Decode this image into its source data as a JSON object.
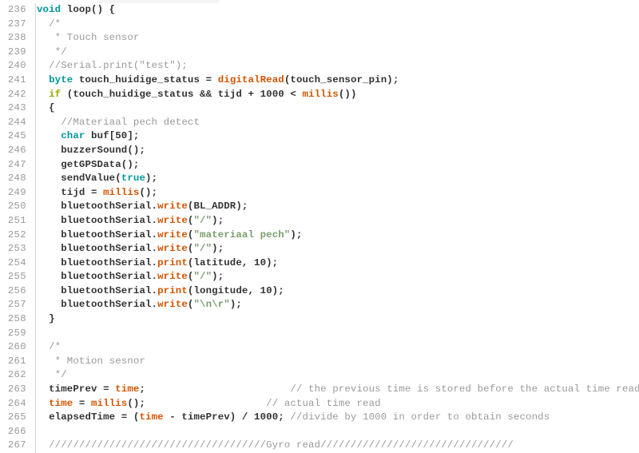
{
  "editor": {
    "app": "arduino-code-editor",
    "background_color": "#ffffff",
    "gutter_color": "#9a9a9a",
    "gutter_rule_color": "#d4d4d4",
    "first_visible_line": 236,
    "last_visible_line": 267,
    "visible_line_count": 32,
    "font": "monospace-bold",
    "colors": {
      "plain": "#333333",
      "keyword": "#00979c",
      "control": "#a1a100",
      "function": "#d35400",
      "string": "#7a9e6c",
      "comment": "#9a9a9a"
    }
  },
  "lines": [
    {
      "n": "236",
      "tokens": [
        {
          "t": "keyword",
          "s": "void"
        },
        {
          "t": "plain",
          "s": " loop() {"
        }
      ]
    },
    {
      "n": "237",
      "tokens": [
        {
          "t": "comment",
          "s": "  /*"
        }
      ]
    },
    {
      "n": "238",
      "tokens": [
        {
          "t": "comment",
          "s": "   * Touch sensor"
        }
      ]
    },
    {
      "n": "239",
      "tokens": [
        {
          "t": "comment",
          "s": "   */"
        }
      ]
    },
    {
      "n": "240",
      "tokens": [
        {
          "t": "comment",
          "s": "  //Serial.print(\"test\");"
        }
      ]
    },
    {
      "n": "241",
      "tokens": [
        {
          "t": "plain",
          "s": "  "
        },
        {
          "t": "keyword",
          "s": "byte"
        },
        {
          "t": "plain",
          "s": " touch_huidige_status = "
        },
        {
          "t": "function",
          "s": "digitalRead"
        },
        {
          "t": "plain",
          "s": "(touch_sensor_pin);"
        }
      ]
    },
    {
      "n": "242",
      "tokens": [
        {
          "t": "plain",
          "s": "  "
        },
        {
          "t": "control",
          "s": "if"
        },
        {
          "t": "plain",
          "s": " (touch_huidige_status && tijd + 1000 < "
        },
        {
          "t": "function",
          "s": "millis"
        },
        {
          "t": "plain",
          "s": "())"
        }
      ]
    },
    {
      "n": "243",
      "tokens": [
        {
          "t": "plain",
          "s": "  {"
        }
      ]
    },
    {
      "n": "244",
      "tokens": [
        {
          "t": "comment",
          "s": "    //Materiaal pech detect"
        }
      ]
    },
    {
      "n": "245",
      "tokens": [
        {
          "t": "plain",
          "s": "    "
        },
        {
          "t": "keyword",
          "s": "char"
        },
        {
          "t": "plain",
          "s": " buf[50];"
        }
      ]
    },
    {
      "n": "246",
      "tokens": [
        {
          "t": "plain",
          "s": "    buzzerSound();"
        }
      ]
    },
    {
      "n": "247",
      "tokens": [
        {
          "t": "plain",
          "s": "    getGPSData();"
        }
      ]
    },
    {
      "n": "248",
      "tokens": [
        {
          "t": "plain",
          "s": "    sendValue("
        },
        {
          "t": "keyword",
          "s": "true"
        },
        {
          "t": "plain",
          "s": ");"
        }
      ]
    },
    {
      "n": "249",
      "tokens": [
        {
          "t": "plain",
          "s": "    tijd = "
        },
        {
          "t": "function",
          "s": "millis"
        },
        {
          "t": "plain",
          "s": "();"
        }
      ]
    },
    {
      "n": "250",
      "tokens": [
        {
          "t": "plain",
          "s": "    bluetoothSerial."
        },
        {
          "t": "function",
          "s": "write"
        },
        {
          "t": "plain",
          "s": "(BL_ADDR);"
        }
      ]
    },
    {
      "n": "251",
      "tokens": [
        {
          "t": "plain",
          "s": "    bluetoothSerial."
        },
        {
          "t": "function",
          "s": "write"
        },
        {
          "t": "plain",
          "s": "("
        },
        {
          "t": "string",
          "s": "\"/\""
        },
        {
          "t": "plain",
          "s": ");"
        }
      ]
    },
    {
      "n": "252",
      "tokens": [
        {
          "t": "plain",
          "s": "    bluetoothSerial."
        },
        {
          "t": "function",
          "s": "write"
        },
        {
          "t": "plain",
          "s": "("
        },
        {
          "t": "string",
          "s": "\"materiaal pech\""
        },
        {
          "t": "plain",
          "s": ");"
        }
      ]
    },
    {
      "n": "253",
      "tokens": [
        {
          "t": "plain",
          "s": "    bluetoothSerial."
        },
        {
          "t": "function",
          "s": "write"
        },
        {
          "t": "plain",
          "s": "("
        },
        {
          "t": "string",
          "s": "\"/\""
        },
        {
          "t": "plain",
          "s": ");"
        }
      ]
    },
    {
      "n": "254",
      "tokens": [
        {
          "t": "plain",
          "s": "    bluetoothSerial."
        },
        {
          "t": "function",
          "s": "print"
        },
        {
          "t": "plain",
          "s": "(latitude, 10);"
        }
      ]
    },
    {
      "n": "255",
      "tokens": [
        {
          "t": "plain",
          "s": "    bluetoothSerial."
        },
        {
          "t": "function",
          "s": "write"
        },
        {
          "t": "plain",
          "s": "("
        },
        {
          "t": "string",
          "s": "\"/\""
        },
        {
          "t": "plain",
          "s": ");"
        }
      ]
    },
    {
      "n": "256",
      "tokens": [
        {
          "t": "plain",
          "s": "    bluetoothSerial."
        },
        {
          "t": "function",
          "s": "print"
        },
        {
          "t": "plain",
          "s": "(longitude, 10);"
        }
      ]
    },
    {
      "n": "257",
      "tokens": [
        {
          "t": "plain",
          "s": "    bluetoothSerial."
        },
        {
          "t": "function",
          "s": "write"
        },
        {
          "t": "plain",
          "s": "("
        },
        {
          "t": "string",
          "s": "\"\\n\\r\""
        },
        {
          "t": "plain",
          "s": ");"
        }
      ]
    },
    {
      "n": "258",
      "tokens": [
        {
          "t": "plain",
          "s": "  }"
        }
      ]
    },
    {
      "n": "259",
      "tokens": [
        {
          "t": "plain",
          "s": ""
        }
      ]
    },
    {
      "n": "260",
      "tokens": [
        {
          "t": "comment",
          "s": "  /*"
        }
      ]
    },
    {
      "n": "261",
      "tokens": [
        {
          "t": "comment",
          "s": "   * Motion sesnor"
        }
      ]
    },
    {
      "n": "262",
      "tokens": [
        {
          "t": "comment",
          "s": "   */"
        }
      ]
    },
    {
      "n": "263",
      "tokens": [
        {
          "t": "plain",
          "s": "  timePrev = "
        },
        {
          "t": "function",
          "s": "time"
        },
        {
          "t": "plain",
          "s": ";                        "
        },
        {
          "t": "comment",
          "s": "// the previous time is stored before the actual time read"
        }
      ]
    },
    {
      "n": "264",
      "tokens": [
        {
          "t": "plain",
          "s": "  "
        },
        {
          "t": "function",
          "s": "time"
        },
        {
          "t": "plain",
          "s": " = "
        },
        {
          "t": "function",
          "s": "millis"
        },
        {
          "t": "plain",
          "s": "();                    "
        },
        {
          "t": "comment",
          "s": "// actual time read"
        }
      ]
    },
    {
      "n": "265",
      "tokens": [
        {
          "t": "plain",
          "s": "  elapsedTime = ("
        },
        {
          "t": "function",
          "s": "time"
        },
        {
          "t": "plain",
          "s": " - timePrev) / 1000; "
        },
        {
          "t": "comment",
          "s": "//divide by 1000 in order to obtain seconds"
        }
      ]
    },
    {
      "n": "266",
      "tokens": [
        {
          "t": "plain",
          "s": ""
        }
      ]
    },
    {
      "n": "267",
      "tokens": [
        {
          "t": "comment",
          "s": "  ////////////////////////////////////Gyro read////////////////////////////////"
        }
      ]
    }
  ]
}
